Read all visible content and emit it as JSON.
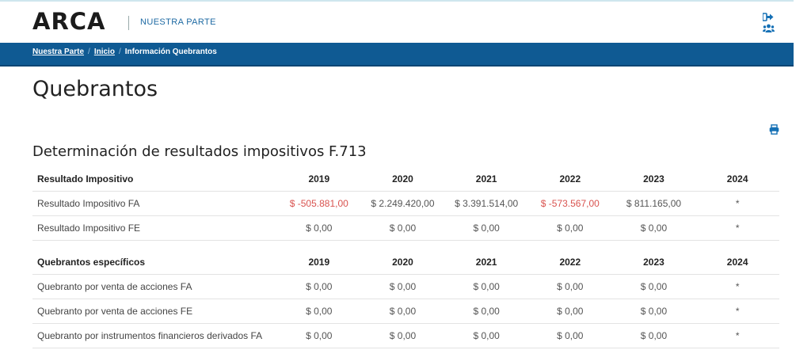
{
  "header": {
    "logo": "ARCA",
    "app_name": "NUESTRA PARTE",
    "icons": [
      "logout-icon",
      "users-icon"
    ]
  },
  "breadcrumb": {
    "items": [
      "Nuestra Parte",
      "Inicio"
    ],
    "current": "Información Quebrantos"
  },
  "page": {
    "title": "Quebrantos",
    "section_title": "Determinación de resultados impositivos F.713"
  },
  "colors": {
    "navbar": "#0f5a93",
    "accent": "#1570b5",
    "negative": "#d9534f"
  },
  "tables": {
    "resultado": {
      "header": [
        "Resultado Impositivo",
        "2019",
        "2020",
        "2021",
        "2022",
        "2023",
        "2024"
      ],
      "rows": [
        [
          "Resultado Impositivo FA",
          "$ -505.881,00",
          "$ 2.249.420,00",
          "$ 3.391.514,00",
          "$ -573.567,00",
          "$ 811.165,00",
          "*"
        ],
        [
          "Resultado Impositivo FE",
          "$ 0,00",
          "$ 0,00",
          "$ 0,00",
          "$ 0,00",
          "$ 0,00",
          "*"
        ]
      ]
    },
    "quebrantos": {
      "header": [
        "Quebrantos específicos",
        "2019",
        "2020",
        "2021",
        "2022",
        "2023",
        "2024"
      ],
      "rows": [
        [
          "Quebranto por venta de acciones FA",
          "$ 0,00",
          "$ 0,00",
          "$ 0,00",
          "$ 0,00",
          "$ 0,00",
          "*"
        ],
        [
          "Quebranto por venta de acciones FE",
          "$ 0,00",
          "$ 0,00",
          "$ 0,00",
          "$ 0,00",
          "$ 0,00",
          "*"
        ],
        [
          "Quebranto por instrumentos financieros derivados FA",
          "$ 0,00",
          "$ 0,00",
          "$ 0,00",
          "$ 0,00",
          "$ 0,00",
          "*"
        ]
      ]
    }
  }
}
